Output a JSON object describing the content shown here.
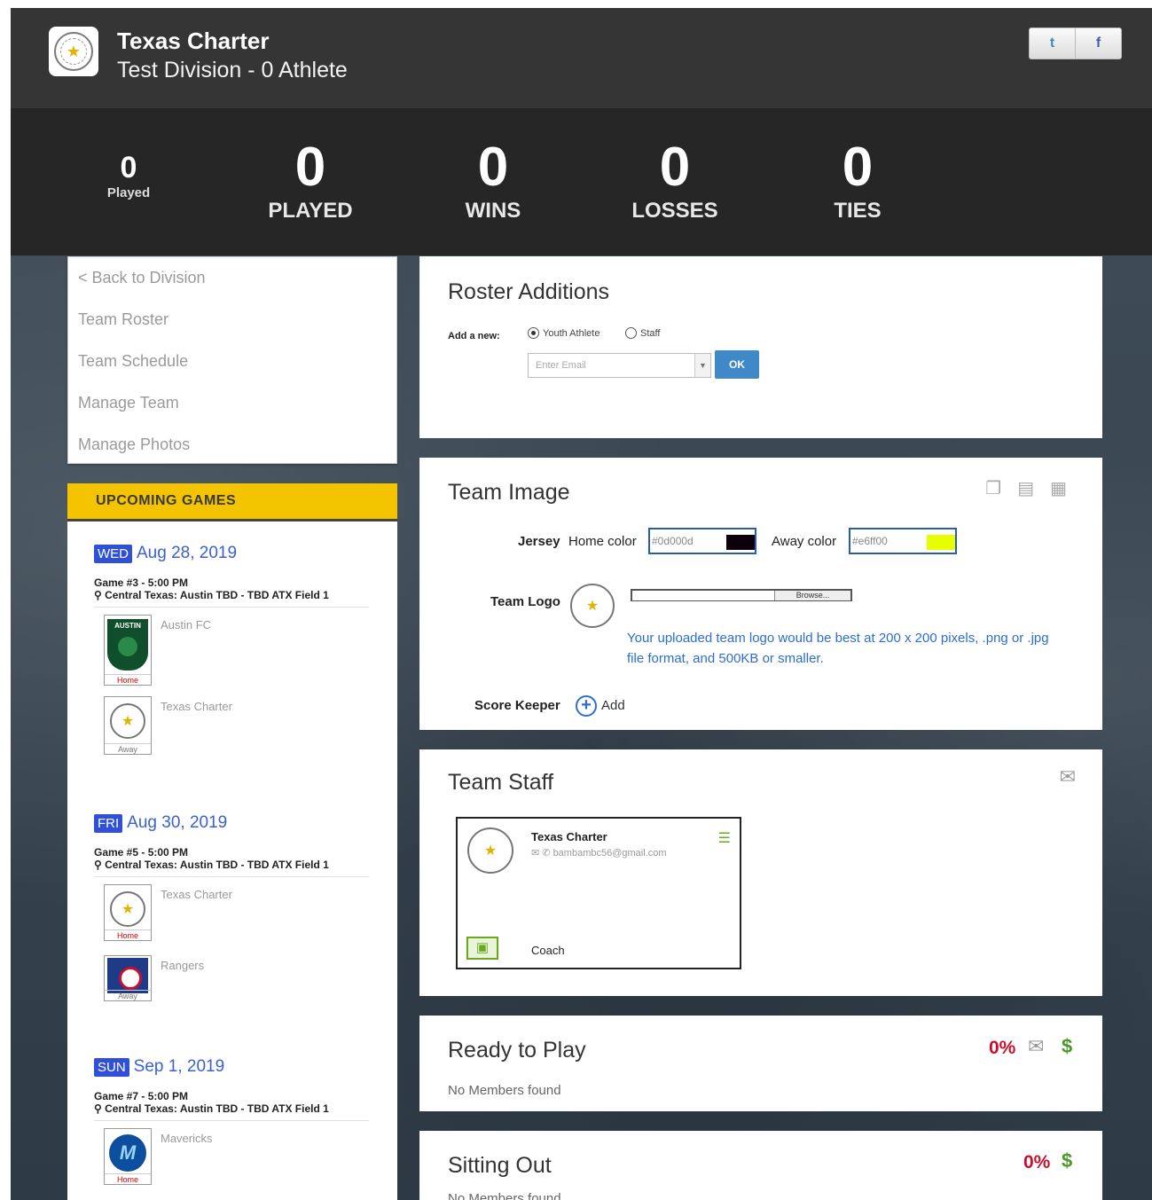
{
  "header": {
    "team_name": "Texas Charter",
    "subtitle": "Test Division - 0 Athlete",
    "social": {
      "twitter": "t",
      "facebook": "f"
    }
  },
  "stats": {
    "small": {
      "value": "0",
      "label": "Played"
    },
    "played": {
      "value": "0",
      "label": "PLAYED"
    },
    "wins": {
      "value": "0",
      "label": "WINS"
    },
    "losses": {
      "value": "0",
      "label": "LOSSES"
    },
    "ties": {
      "value": "0",
      "label": "TIES"
    }
  },
  "nav": [
    "< Back to Division",
    "Team Roster",
    "Team Schedule",
    "Manage Team",
    "Manage Photos"
  ],
  "upcoming": {
    "title": "UPCOMING GAMES",
    "games": [
      {
        "day": "WED",
        "date": "Aug 28, 2019",
        "line1": "Game #3 - 5:00 PM",
        "line2": "⚲ Central Texas: Austin TBD - TBD ATX Field 1",
        "home": {
          "name": "Austin FC",
          "tag": "Home"
        },
        "away": {
          "name": "Texas Charter",
          "tag": "Away"
        }
      },
      {
        "day": "FRI",
        "date": "Aug 30, 2019",
        "line1": "Game #5 - 5:00 PM",
        "line2": "⚲ Central Texas: Austin TBD - TBD ATX Field 1",
        "home": {
          "name": "Texas Charter",
          "tag": "Home"
        },
        "away": {
          "name": "Rangers",
          "tag": "Away"
        }
      },
      {
        "day": "SUN",
        "date": "Sep 1, 2019",
        "line1": "Game #7 - 5:00 PM",
        "line2": "⚲ Central Texas: Austin TBD - TBD ATX Field 1",
        "home": {
          "name": "Mavericks",
          "tag": "Home"
        }
      }
    ]
  },
  "roster": {
    "title": "Roster Additions",
    "add_label": "Add a new:",
    "option_youth": "Youth Athlete",
    "option_staff": "Staff",
    "email_placeholder": "Enter Email",
    "ok_label": "OK"
  },
  "team_image": {
    "title": "Team Image",
    "jersey_label": "Jersey",
    "home_color_label": "Home color",
    "home_color": "#0d000d",
    "away_color_label": "Away color",
    "away_color": "#e6ff00",
    "logo_label": "Team Logo",
    "browse_label": "Browse...",
    "hint": "Your uploaded team logo would be best at 200 x 200 pixels, .png or .jpg file format, and 500KB or smaller.",
    "score_keeper_label": "Score Keeper",
    "add_label": "Add"
  },
  "team_staff": {
    "title": "Team Staff",
    "member": {
      "name": "Texas Charter",
      "email": "bambambc56@gmail.com",
      "role": "Coach"
    }
  },
  "ready": {
    "title": "Ready to Play",
    "empty": "No Members found",
    "percent": "0%"
  },
  "sitting": {
    "title": "Sitting Out",
    "empty": "No Members found",
    "percent": "0%"
  }
}
